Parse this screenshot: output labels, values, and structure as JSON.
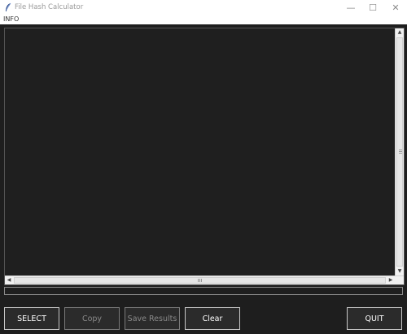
{
  "window": {
    "title": "File Hash Calculator",
    "icon": "feather-icon",
    "controls": {
      "minimize": "—",
      "maximize": "☐",
      "close": "✕"
    }
  },
  "menu": {
    "items": [
      {
        "label": "INFO"
      }
    ]
  },
  "output": {
    "text": "",
    "scroll_up": "▲",
    "scroll_down": "▼",
    "scroll_left": "◀",
    "scroll_right": "▶"
  },
  "progress": {
    "value": 0
  },
  "buttons": {
    "select": {
      "label": "SELECT",
      "enabled": true
    },
    "copy": {
      "label": "Copy",
      "enabled": false
    },
    "save": {
      "label": "Save Results",
      "enabled": false
    },
    "clear": {
      "label": "Clear",
      "enabled": true
    },
    "quit": {
      "label": "QUIT",
      "enabled": true
    }
  },
  "colors": {
    "background": "#1e1e1e",
    "text_area": "#1f1f1f",
    "button_bg": "#2b2b2b",
    "button_border": "#c8c8c8",
    "disabled_text": "#8a8a8a"
  }
}
